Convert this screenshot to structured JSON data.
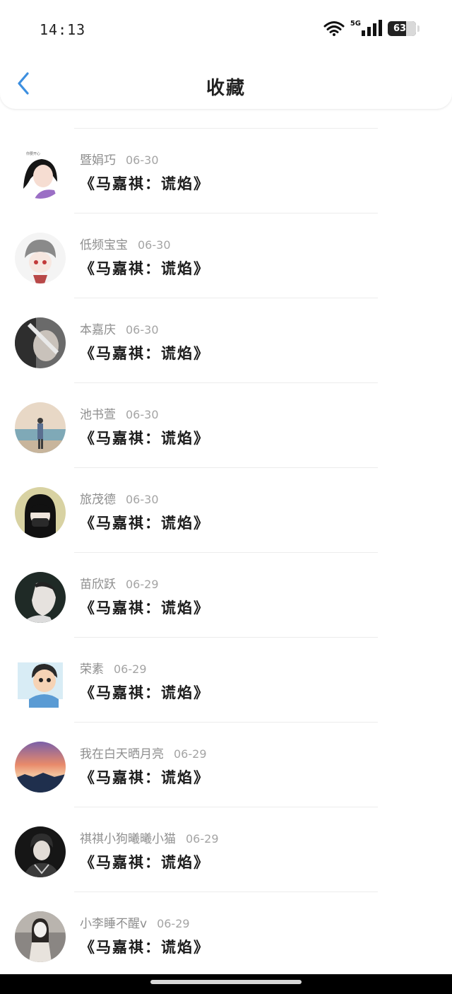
{
  "status_bar": {
    "time": "14:13",
    "network": "5G",
    "battery": "63"
  },
  "header": {
    "title": "收藏"
  },
  "items": [
    {
      "user": "",
      "date": "",
      "title": ""
    },
    {
      "user": "暨娟巧",
      "date": "06-30",
      "title": "《马嘉祺：谎焰》"
    },
    {
      "user": "低频宝宝",
      "date": "06-30",
      "title": "《马嘉祺：谎焰》"
    },
    {
      "user": "本嘉庆",
      "date": "06-30",
      "title": "《马嘉祺：谎焰》"
    },
    {
      "user": "池书萱",
      "date": "06-30",
      "title": "《马嘉祺：谎焰》"
    },
    {
      "user": "旅茂德",
      "date": "06-30",
      "title": "《马嘉祺：谎焰》"
    },
    {
      "user": "苗欣跃",
      "date": "06-29",
      "title": "《马嘉祺：谎焰》"
    },
    {
      "user": "荣素",
      "date": "06-29",
      "title": "《马嘉祺：谎焰》"
    },
    {
      "user": "我在白天晒月亮",
      "date": "06-29",
      "title": "《马嘉祺：谎焰》"
    },
    {
      "user": "祺祺小狗曦曦小猫",
      "date": "06-29",
      "title": "《马嘉祺：谎焰》"
    },
    {
      "user": "小李睡不醒v",
      "date": "06-29",
      "title": "《马嘉祺：谎焰》"
    }
  ],
  "icons": {
    "back": "chevron-left-icon",
    "wifi": "wifi-icon",
    "signal": "cellular-signal-icon",
    "battery": "battery-icon"
  },
  "colors": {
    "accent": "#3d8fe0",
    "text": "#1a1a1a",
    "muted": "#8e8e8e"
  }
}
